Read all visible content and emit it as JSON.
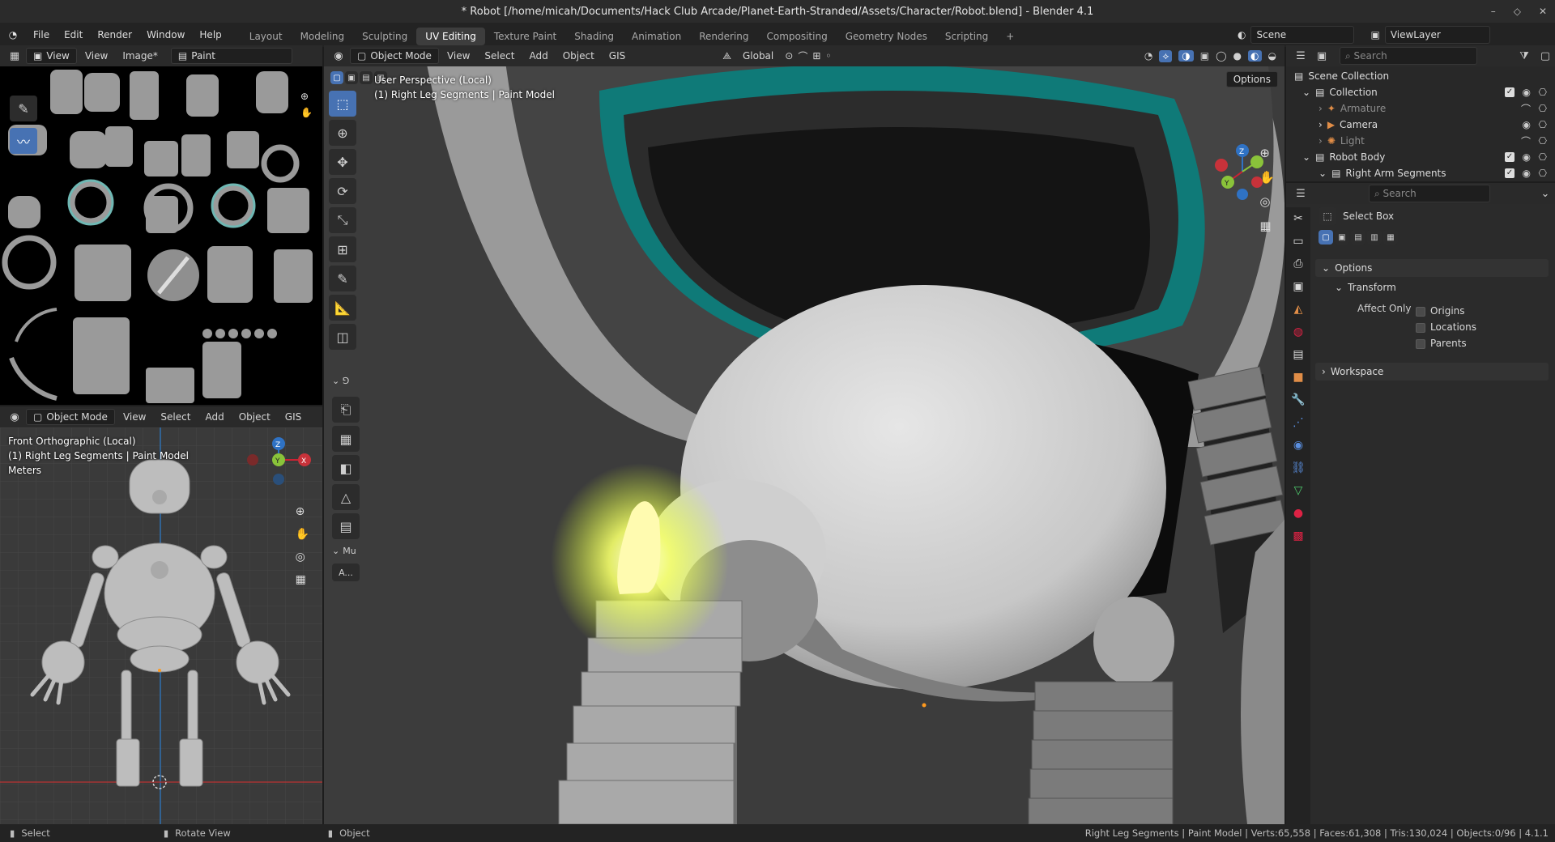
{
  "window": {
    "title": "* Robot [/home/micah/Documents/Hack Club Arcade/Planet-Earth-Stranded/Assets/Character/Robot.blend] - Blender 4.1"
  },
  "menu": [
    "File",
    "Edit",
    "Render",
    "Window",
    "Help"
  ],
  "workspaces": [
    "Layout",
    "Modeling",
    "Sculpting",
    "UV Editing",
    "Texture Paint",
    "Shading",
    "Animation",
    "Rendering",
    "Compositing",
    "Geometry Nodes",
    "Scripting"
  ],
  "active_workspace": "UV Editing",
  "scene": {
    "name": "Scene",
    "view_layer": "ViewLayer"
  },
  "uv_editor": {
    "menus": [
      "View",
      "View",
      "Image*"
    ],
    "mode": "Paint"
  },
  "small_viewport": {
    "mode": "Object Mode",
    "menus": [
      "View",
      "Select",
      "Add",
      "Object",
      "GIS"
    ],
    "overlay_lines": [
      "Front Orthographic (Local)",
      "(1) Right Leg Segments | Paint Model",
      "Meters"
    ]
  },
  "main_viewport": {
    "mode": "Object Mode",
    "menus": [
      "View",
      "Select",
      "Add",
      "Object",
      "GIS"
    ],
    "transform_orientation": "Global",
    "options_label": "Options",
    "overlay_lines": [
      "User Perspective (Local)",
      "(1) Right Leg Segments | Paint Model"
    ],
    "side_labels": [
      "Mu",
      "A..."
    ]
  },
  "outliner": {
    "search_placeholder": "Search",
    "rows": [
      {
        "label": "Scene Collection",
        "indent": 0
      },
      {
        "label": "Collection",
        "indent": 1
      },
      {
        "label": "Armature",
        "indent": 2
      },
      {
        "label": "Camera",
        "indent": 2
      },
      {
        "label": "Light",
        "indent": 2
      },
      {
        "label": "Robot Body",
        "indent": 1
      },
      {
        "label": "Right Arm Segments",
        "indent": 2
      }
    ]
  },
  "properties": {
    "search_placeholder": "Search",
    "tool_name": "Select Box",
    "options_label": "Options",
    "transform_label": "Transform",
    "affect_only_label": "Affect Only",
    "checkboxes": [
      "Origins",
      "Locations",
      "Parents"
    ],
    "workspace_label": "Workspace"
  },
  "statusbar": {
    "left": [
      "Select",
      "Rotate View",
      "Object"
    ],
    "right": "Right Leg Segments | Paint Model | Verts:65,558 | Faces:61,308 | Tris:130,024 | Objects:0/96 | 4.1.1"
  },
  "colors": {
    "accent": "#4772b3",
    "teal": "#0f7a78",
    "glow": "#fffbb0"
  }
}
